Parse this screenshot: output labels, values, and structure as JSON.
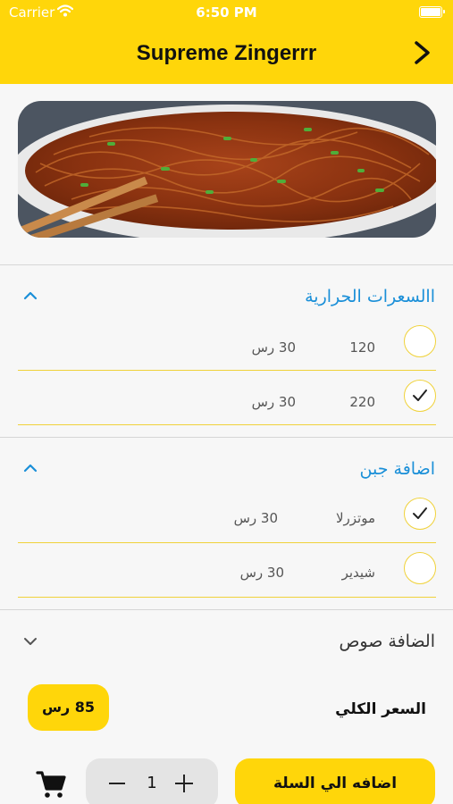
{
  "status_bar": {
    "carrier": "Carrier",
    "time": "6:50 PM"
  },
  "header": {
    "title": "Supreme Zingerrr",
    "back_icon": "chevron-right-icon"
  },
  "colors": {
    "accent": "#ffd60a",
    "link": "#1a8fd8",
    "row_border": "#f0d23a"
  },
  "sections": [
    {
      "title": "االسعرات الحرارية",
      "expanded": true,
      "options": [
        {
          "name": "120",
          "price": "30 رس",
          "selected": false
        },
        {
          "name": "220",
          "price": "30 رس",
          "selected": true
        }
      ]
    },
    {
      "title": "اضافة جبن",
      "expanded": true,
      "options": [
        {
          "name": "موتزرلا",
          "price": "30 رس",
          "selected": true
        },
        {
          "name": "شيدير",
          "price": "30 رس",
          "selected": false
        }
      ]
    },
    {
      "title": "الضافة صوص",
      "expanded": false,
      "options": []
    }
  ],
  "total": {
    "label": "السعر الكلي",
    "price": "85 رس"
  },
  "cart": {
    "quantity": "1",
    "add_label": "اضافه الي السلة",
    "cart_icon": "cart-icon"
  }
}
